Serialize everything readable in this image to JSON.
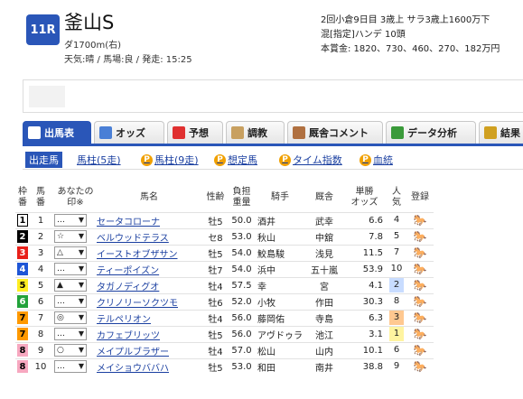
{
  "race": {
    "number": "11R",
    "name": "釜山S",
    "distance": "ダ1700m(右)",
    "conditions": "天気:晴 / 馬場:良 / 発走: 15:25",
    "meta1": "2回小倉9日目 3歳上 サラ3歳上1600万下",
    "meta2": "混[指定]ハンデ 10頭",
    "meta3": "本賞金: 1820、730、460、270、182万円"
  },
  "tabs": [
    {
      "label": "出馬表",
      "active": true,
      "icon_color": "#ffffff",
      "icon": "table-icon"
    },
    {
      "label": "オッズ",
      "active": false,
      "icon_color": "#4a7fd6",
      "icon": "odds-icon"
    },
    {
      "label": "予想",
      "active": false,
      "icon_color": "#e03030",
      "icon": "target-icon"
    },
    {
      "label": "調教",
      "active": false,
      "icon_color": "#c8a060",
      "icon": "stopwatch-icon"
    },
    {
      "label": "厩舎コメント",
      "active": false,
      "icon_color": "#b07040",
      "icon": "stable-icon"
    },
    {
      "label": "データ分析",
      "active": false,
      "icon_color": "#3a9a3a",
      "icon": "chart-icon"
    },
    {
      "label": "結果",
      "active": false,
      "icon_color": "#d0a020",
      "icon": "trophy-icon"
    }
  ],
  "subnav": [
    {
      "label": "出走馬",
      "active": true,
      "premium": false
    },
    {
      "label": "馬柱(5走)",
      "active": false,
      "premium": false
    },
    {
      "label": "馬柱(9走)",
      "active": false,
      "premium": true
    },
    {
      "label": "想定馬",
      "active": false,
      "premium": true
    },
    {
      "label": "タイム指数",
      "active": false,
      "premium": true
    },
    {
      "label": "血統",
      "active": false,
      "premium": true
    }
  ],
  "premium_badge": "P",
  "headers": {
    "waku": "枠\n番",
    "num": "馬\n番",
    "mark": "あなたの印※",
    "name": "馬名",
    "sex": "性齢",
    "weight": "負担\n重量",
    "jockey": "騎手",
    "trainer": "厩舎",
    "odds": "単勝\nオッズ",
    "pop": "人\n気",
    "reg": "登録"
  },
  "waku_colors": {
    "1": {
      "bg": "#ffffff",
      "fg": "#000000",
      "border": "#000000"
    },
    "2": {
      "bg": "#000000",
      "fg": "#ffffff",
      "border": "#000000"
    },
    "3": {
      "bg": "#e8201a",
      "fg": "#ffffff",
      "border": "#e8201a"
    },
    "4": {
      "bg": "#1f56d6",
      "fg": "#ffffff",
      "border": "#1f56d6"
    },
    "5": {
      "bg": "#ffee22",
      "fg": "#000000",
      "border": "#ffee22"
    },
    "6": {
      "bg": "#22a23a",
      "fg": "#ffffff",
      "border": "#22a23a"
    },
    "7": {
      "bg": "#ff9900",
      "fg": "#000000",
      "border": "#ff9900"
    },
    "8": {
      "bg": "#f7a8c0",
      "fg": "#000000",
      "border": "#f7a8c0"
    }
  },
  "pop_colors": {
    "1": "#fff4a0",
    "2": "#c8dcff",
    "3": "#ffc890"
  },
  "entries": [
    {
      "waku": "1",
      "num": "1",
      "mark": "…",
      "name": "セータコローナ",
      "sex": "牡5",
      "weight": "50.0",
      "jockey": "酒井",
      "trainer": "武幸",
      "odds": "6.6",
      "pop": "4"
    },
    {
      "waku": "2",
      "num": "2",
      "mark": "☆",
      "name": "ベルウッドテラス",
      "sex": "セ8",
      "weight": "53.0",
      "jockey": "秋山",
      "trainer": "中舘",
      "odds": "7.8",
      "pop": "5"
    },
    {
      "waku": "3",
      "num": "3",
      "mark": "△",
      "name": "イーストオブザサン",
      "sex": "牡5",
      "weight": "54.0",
      "jockey": "鮫島駿",
      "trainer": "浅見",
      "odds": "11.5",
      "pop": "7"
    },
    {
      "waku": "4",
      "num": "4",
      "mark": "…",
      "name": "ティーポイズン",
      "sex": "牡7",
      "weight": "54.0",
      "jockey": "浜中",
      "trainer": "五十嵐",
      "odds": "53.9",
      "pop": "10"
    },
    {
      "waku": "5",
      "num": "5",
      "mark": "▲",
      "name": "タガノディグオ",
      "sex": "牡4",
      "weight": "57.5",
      "jockey": "幸",
      "trainer": "宮",
      "odds": "4.1",
      "pop": "2"
    },
    {
      "waku": "6",
      "num": "6",
      "mark": "…",
      "name": "クリノリーソクツモ",
      "sex": "牡6",
      "weight": "52.0",
      "jockey": "小牧",
      "trainer": "作田",
      "odds": "30.3",
      "pop": "8"
    },
    {
      "waku": "7",
      "num": "7",
      "mark": "◎",
      "name": "テルペリオン",
      "sex": "牡4",
      "weight": "56.0",
      "jockey": "藤岡佑",
      "trainer": "寺島",
      "odds": "6.3",
      "pop": "3"
    },
    {
      "waku": "7",
      "num": "8",
      "mark": "…",
      "name": "カフェブリッツ",
      "sex": "牡5",
      "weight": "56.0",
      "jockey": "アヴドゥラ",
      "trainer": "池江",
      "odds": "3.1",
      "pop": "1"
    },
    {
      "waku": "8",
      "num": "9",
      "mark": "○",
      "name": "メイプルブラザー",
      "sex": "牡4",
      "weight": "57.0",
      "jockey": "松山",
      "trainer": "山内",
      "odds": "10.1",
      "pop": "6"
    },
    {
      "waku": "8",
      "num": "10",
      "mark": "…",
      "name": "メイショウババハ",
      "sex": "牡5",
      "weight": "53.0",
      "jockey": "和田",
      "trainer": "南井",
      "odds": "38.8",
      "pop": "9"
    }
  ]
}
